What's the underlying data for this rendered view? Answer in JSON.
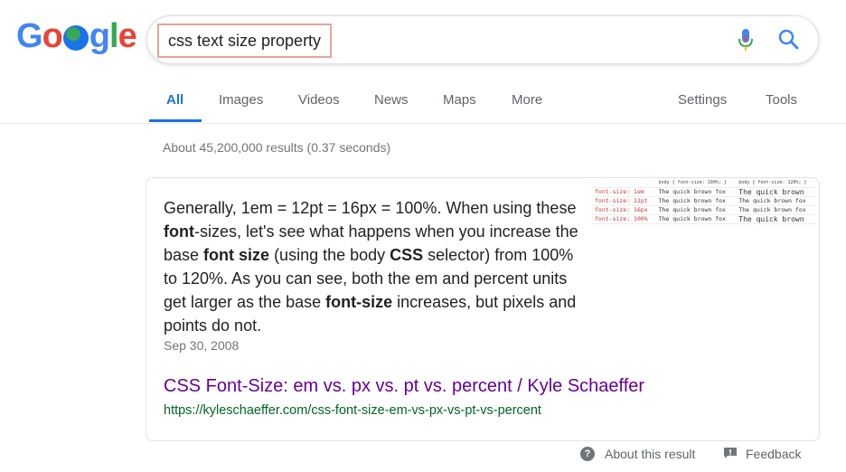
{
  "logo": {
    "letters": [
      "G",
      "o",
      "",
      "g",
      "l",
      "e"
    ]
  },
  "search": {
    "query": "css text size property"
  },
  "tabs": [
    {
      "label": "All"
    },
    {
      "label": "Images"
    },
    {
      "label": "Videos"
    },
    {
      "label": "News"
    },
    {
      "label": "Maps"
    },
    {
      "label": "More"
    }
  ],
  "tools": {
    "settings": "Settings",
    "tools": "Tools"
  },
  "stats": "About 45,200,000 results (0.37 seconds)",
  "snippet": {
    "parts": [
      "Generally, 1em = 12pt = 16px = 100%. When using these ",
      "font",
      "-sizes, let's see what happens when you increase the base ",
      "font size",
      " (using the body ",
      "CSS",
      " selector) from 100% to 120%. As you can see, both the em and percent units get larger as the base ",
      "font-size",
      " increases, but pixels and points do not."
    ],
    "date": "Sep 30, 2008",
    "title": "CSS Font-Size: em vs. px vs. pt vs. percent / Kyle Schaeffer",
    "url": "https://kyleschaeffer.com/css-font-size-em-vs-px-vs-pt-vs-percent"
  },
  "thumbnail": {
    "headers": [
      "body { font-size: 100%; }",
      "body { font-size: 120%; }"
    ],
    "rows": [
      {
        "key": "font-size: 1em",
        "a": "The quick brown fox",
        "b": "The quick brown"
      },
      {
        "key": "font-size: 12pt",
        "a": "The quick brown fox",
        "b": "The quick brown fox"
      },
      {
        "key": "font-size: 16px",
        "a": "The quick brown fox",
        "b": "The quick brown fox"
      },
      {
        "key": "font-size: 100%",
        "a": "The quick brown fox",
        "b": "The quick brown"
      }
    ]
  },
  "footer": {
    "about": "About this result",
    "feedback": "Feedback"
  },
  "colors": {
    "blue": "#4285f4",
    "red": "#ea4335",
    "yellow": "#fbbc05",
    "green": "#34a853",
    "visited": "#660099",
    "url": "#006621"
  }
}
